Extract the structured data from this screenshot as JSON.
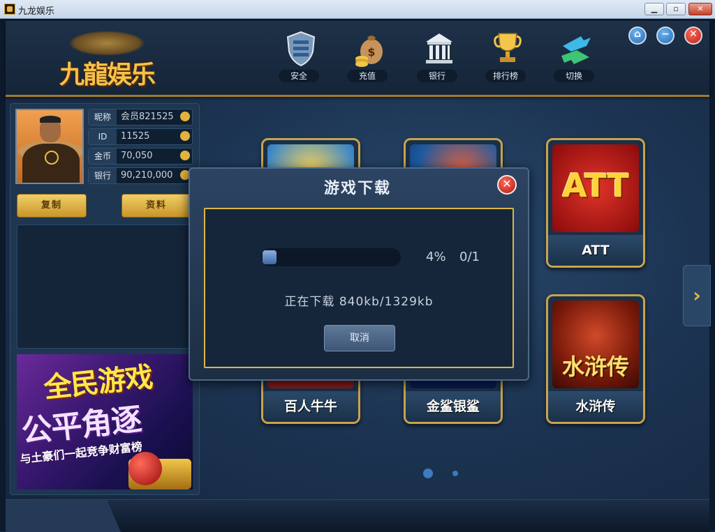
{
  "window": {
    "title": "九龙娱乐"
  },
  "logo": {
    "text": "九龍娱乐"
  },
  "toolbar": {
    "items": [
      {
        "label": "安全",
        "icon": "shield-icon"
      },
      {
        "label": "充值",
        "icon": "money-bag-icon"
      },
      {
        "label": "银行",
        "icon": "bank-icon"
      },
      {
        "label": "排行榜",
        "icon": "trophy-icon"
      },
      {
        "label": "切换",
        "icon": "switch-icon"
      }
    ]
  },
  "profile": {
    "nickname_label": "昵称",
    "nickname": "会员821525",
    "id_label": "ID",
    "id": "11525",
    "gold_label": "金币",
    "gold": "70,050",
    "bank_label": "银行",
    "bank": "90,210,000",
    "copy_button": "复制",
    "info_button": "资料"
  },
  "banner": {
    "line1": "全民游戏",
    "line2": "公平角逐",
    "line3": "与土豪们一起竞争财富榜"
  },
  "games": [
    {
      "name": "ATT"
    },
    {
      "name": "百人牛牛"
    },
    {
      "name": "金鲨银鲨"
    },
    {
      "name": "水浒传"
    }
  ],
  "dialog": {
    "title": "游戏下载",
    "progress_percent": "4%",
    "progress_value": 0.04,
    "count": "0/1",
    "status": "正在下载 840kb/1329kb",
    "cancel": "取消"
  },
  "pager": {
    "pages": 2,
    "current": 1
  },
  "colors": {
    "accent_gold": "#c8a44e",
    "bg": "#1c3452"
  }
}
